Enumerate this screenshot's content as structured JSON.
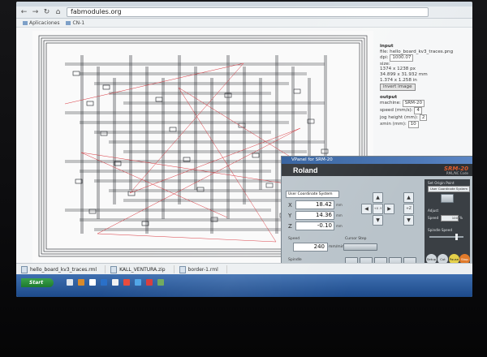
{
  "browser": {
    "tab_title": "",
    "back": "←",
    "forward": "→",
    "reload": "↻",
    "home": "⌂",
    "url": "fabmodules.org",
    "bookmarks": [
      "Aplicaciones",
      "CN-1"
    ]
  },
  "side_panel": {
    "input_heading": "input",
    "file_line": "file: hello_board_kv3_traces.png",
    "dpi_label": "dpi:",
    "dpi_value": "1000.07",
    "size_label": "size:",
    "size_px": "1374 x 1238 px",
    "size_mm": "34.899 x 31.932 mm",
    "size_in": "1.374 x 1.258 in",
    "invert_button": "invert image",
    "output_heading": "output",
    "machine_label": "machine:",
    "machine_value": "SRM-20",
    "speed_label": "speed (mm/s):",
    "speed_value": "4",
    "jog_label": "jog height (mm):",
    "jog_value": "2",
    "xmin_label": "xmin (mm):",
    "xmin_value": "10"
  },
  "vpanel": {
    "window_title": "VPanel for SRM-20",
    "brand": "Roland",
    "model": "SRM-20",
    "subtitle": "RML/NC Code",
    "coord_system": "User Coordinate System",
    "x_label": "X",
    "x_value": "18.42",
    "y_label": "Y",
    "y_value": "14.36",
    "z_label": "Z",
    "z_value": "-0.10",
    "unit": "mm",
    "speed_label": "Speed",
    "speed_value": "240",
    "speed_unit": "mm/min",
    "spindle_label": "Spindle",
    "spindle_value": "8640",
    "spindle_unit": "RPM",
    "cursor_step": "Cursor Step",
    "set_origin_label": "Set Origin Point",
    "set_origin_value": "User Coordinate System",
    "adjust_label": "Adjust",
    "adjust_speed_label": "Speed",
    "adjust_speed_value": "100",
    "adjust_speed_unit": "%",
    "spindle_speed_label": "Spindle Speed",
    "btn_setup": "Setup",
    "btn_cut": "Cut",
    "btn_pause": "Pause",
    "btn_stop": "Stop",
    "jog_center": "+X -Y",
    "z_up": "+Z",
    "z_down": "-Z"
  },
  "downloads": [
    "hello_board_kv3_traces.rml",
    "KALL_VENTURA.zip",
    "border-1.rml"
  ],
  "taskbar": {
    "start": "Start"
  },
  "colors": {
    "trace": "#1c1f24",
    "path_red": "#d8343c",
    "taskbar": "#2557a0",
    "vpanel_accent": "#e05c2c"
  }
}
